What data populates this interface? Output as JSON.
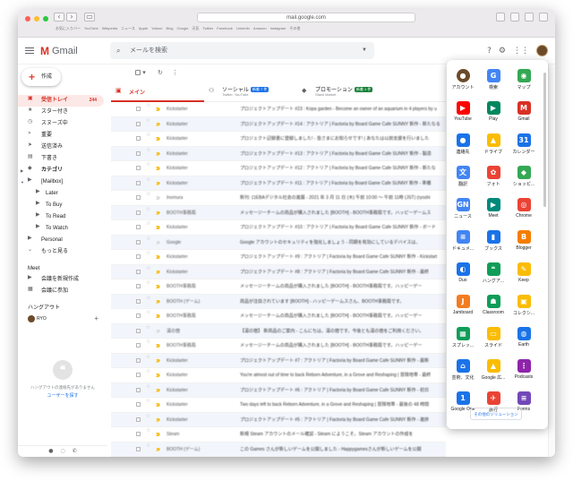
{
  "browser": {
    "url": "mail.google.com",
    "bookmarks": [
      "お気に入りバー",
      "YouTube",
      "Wikipedia",
      "ニュース",
      "Apple",
      "Yahoo!",
      "Bing",
      "Google",
      "天気",
      "Twitter",
      "Facebook",
      "LinkedIn",
      "Amazon",
      "Instagram",
      "その他"
    ]
  },
  "header": {
    "app_name": "Gmail",
    "search_placeholder": "メールを検索"
  },
  "compose": {
    "label": "作成"
  },
  "sidebar": {
    "items": [
      {
        "label": "受信トレイ",
        "icon": "inbox-icon",
        "count": "244",
        "active": true
      },
      {
        "label": "スター付き",
        "icon": "star-icon"
      },
      {
        "label": "スヌーズ中",
        "icon": "clock-icon"
      },
      {
        "label": "重要",
        "icon": "important-icon"
      },
      {
        "label": "送信済み",
        "icon": "send-icon"
      },
      {
        "label": "下書き",
        "icon": "draft-icon"
      },
      {
        "label": "カテゴリ",
        "icon": "category-icon",
        "bold": true
      },
      {
        "label": "[Mailbox]",
        "icon": "label-icon"
      }
    ],
    "mailbox_children": [
      {
        "label": "Later"
      },
      {
        "label": "To Buy"
      },
      {
        "label": "To Read"
      },
      {
        "label": "To Watch"
      }
    ],
    "more_items": [
      {
        "label": "Personal"
      },
      {
        "label": "もっと見る"
      }
    ],
    "meet_title": "Meet",
    "meet_items": [
      {
        "label": "会議を新規作成"
      },
      {
        "label": "会議に参加"
      }
    ],
    "hangouts_title": "ハングアウト",
    "hangouts_user": "RYO",
    "hangouts_empty": "ハングアウトの連絡先がありません",
    "hangouts_link": "ユーザーを探す"
  },
  "tabs": [
    {
      "label": "メイン",
      "icon": "inbox-icon"
    },
    {
      "label": "ソーシャル",
      "badge": "新着 7 件",
      "badge_color": "#1a73e8",
      "sub": "Twitter, YouTube"
    },
    {
      "label": "プロモーション",
      "badge": "新着 1 件",
      "badge_color": "#188038",
      "sub": "Stack Market"
    }
  ],
  "emails": [
    {
      "sender": "Kickstarter",
      "subject": "プロジェクトアップデート #23 : Kopa garden - Become an owner of an aquarium in 4 players by u",
      "important": true
    },
    {
      "sender": "Kickstarter",
      "subject": "プロジェクトアップデート #14 : アクトリア | Factoria by Board Game Cafe SUNNY 新作 - 新たなる",
      "important": true
    },
    {
      "sender": "Kickstarter",
      "subject": "プロジェクト記録書に登録しました! - 皆さまにお知らせです! | あなたは以前支援を行いました",
      "important": true
    },
    {
      "sender": "Kickstarter",
      "subject": "プロジェクトアップデート #13 : アクトリア | Factoria by Board Game Cafe SUNNY 新作 - 製造",
      "important": true
    },
    {
      "sender": "Kickstarter",
      "subject": "プロジェクトアップデート #12 : アクトリア | Factoria by Board Game Cafe SUNNY 新作 - 新たな",
      "important": true
    },
    {
      "sender": "Kickstarter",
      "subject": "プロジェクトアップデート #11 : アクトリア | Factoria by Board Game Cafe SUNNY 新作 - 準備",
      "important": true
    },
    {
      "sender": "Inomura",
      "subject": "新刊: ロEBAデジタル社会の進展 - 2021 年 3 月 11 日 (木) 午前 10:00 ～ 午前 11時 (JST) (ryoshi",
      "important": false
    },
    {
      "sender": "BOOTH事務局",
      "subject": "メッセージーチームの商品が購入されました [BOOTH] - BOOTH事務局です。ハッピーゲームス",
      "important": true
    },
    {
      "sender": "Kickstarter",
      "subject": "プロジェクトアップデート #10 : アクトリア | Factoria by Board Game Cafe SUNNY 新作 - ボード",
      "important": true
    },
    {
      "sender": "Google",
      "subject": "Google アカウントのセキュリティを強化しましょう - 同期を有効にしているデバイスは、",
      "important": false
    },
    {
      "sender": "Kickstarter",
      "subject": "プロジェクトアップデート #9 : アクトリア | Factoria by Board Game Cafe SUNNY 新作 - Kickstart",
      "important": true
    },
    {
      "sender": "Kickstarter",
      "subject": "プロジェクトアップデート #8 : アクトリア | Factoria by Board Game Cafe SUNNY 新作 - 最終",
      "important": true
    },
    {
      "sender": "BOOTH事務局",
      "subject": "メッセージーチームの商品が購入されました [BOOTH] - BOOTH事務局です。ハッピーゲー",
      "important": true
    },
    {
      "sender": "BOOTH (ゲーム)",
      "subject": "商品が注目されています [BOOTH] - ハッピーゲームスさん、BOOTH事務局です。",
      "important": true
    },
    {
      "sender": "BOOTH事務局",
      "subject": "メッセージーチームの商品が購入されました [BOOTH] - BOOTH事務局です。ハッピーゲー",
      "important": true
    },
    {
      "sender": "湯の宿",
      "subject": "【湯の宿】 新商品のご案内 - こんにちは。湯の宿です。今後とも湯の宿をご利用ください。",
      "important": false
    },
    {
      "sender": "BOOTH事務局",
      "subject": "メッセージーチームの商品が購入されました [BOOTH] - BOOTH事務局です。ハッピーゲー",
      "important": true
    },
    {
      "sender": "Kickstarter",
      "subject": "プロジェクトアップデート #7 : アクトリア | Factoria by Board Game Cafe SUNNY 新作 - 最新",
      "important": true
    },
    {
      "sender": "Kickstarter",
      "subject": "You're almost out of time to back Reborn Adventure, in a Grove and Reshaping | 冒険地帯 - 最終",
      "important": true
    },
    {
      "sender": "Kickstarter",
      "subject": "プロジェクトアップデート #6 : アクトリア | Factoria by Board Game Cafe SUNNY 新作 - 初日",
      "important": true
    },
    {
      "sender": "Kickstarter",
      "subject": "Two days left to back Reborn Adventure, in a Grove and Reshaping | 冒険地帯 - 最後の 48 時間",
      "important": true
    },
    {
      "sender": "Kickstarter",
      "subject": "プロジェクトアップデート #5 : アクトリア | Factoria by Board Game Cafe SUNNY 新作 - 進捗",
      "important": true
    },
    {
      "sender": "Steam",
      "subject": "新規 Steam アカウントのメール確認 - Steam にようこそ。Steam アカウントの作成を",
      "important": true
    },
    {
      "sender": "BOOTH (ゲーム)",
      "subject": "この Games さんが新しいゲームを公開しました - Happygamesさんが新しいゲームを公開",
      "important": true
    },
    {
      "sender": "BOOTH事務局",
      "subject": "メッセージーチームの商品が購入されました [BOOTH] - BOOTH事務局です。",
      "important": true
    }
  ],
  "apps": [
    {
      "label": "アカウント",
      "icon": "account-icon",
      "color": "#6b4a2a",
      "glyph": "●"
    },
    {
      "label": "検索",
      "icon": "google-search-icon",
      "color": "#4285f4",
      "glyph": "G"
    },
    {
      "label": "マップ",
      "icon": "maps-icon",
      "color": "#34a853",
      "glyph": "◉"
    },
    {
      "label": "YouTube",
      "icon": "youtube-icon",
      "color": "#ff0000",
      "glyph": "▶"
    },
    {
      "label": "Play",
      "icon": "play-icon",
      "color": "#01875f",
      "glyph": "▶"
    },
    {
      "label": "Gmail",
      "icon": "gmail-icon",
      "color": "#d93025",
      "glyph": "M"
    },
    {
      "label": "連絡先",
      "icon": "contacts-icon",
      "color": "#1a73e8",
      "glyph": "●"
    },
    {
      "label": "ドライブ",
      "icon": "drive-icon",
      "color": "#fbbc04",
      "glyph": "▲"
    },
    {
      "label": "カレンダー",
      "icon": "calendar-icon",
      "color": "#1a73e8",
      "glyph": "31"
    },
    {
      "label": "翻訳",
      "icon": "translate-icon",
      "color": "#4285f4",
      "glyph": "文"
    },
    {
      "label": "フォト",
      "icon": "photos-icon",
      "color": "#ea4335",
      "glyph": "✿"
    },
    {
      "label": "ショッピ...",
      "icon": "shopping-icon",
      "color": "#34a853",
      "glyph": "◆"
    },
    {
      "label": "ニュース",
      "icon": "news-icon",
      "color": "#4285f4",
      "glyph": "GN"
    },
    {
      "label": "Meet",
      "icon": "meet-icon",
      "color": "#00897b",
      "glyph": "▶"
    },
    {
      "label": "Chrome",
      "icon": "chrome-icon",
      "color": "#ea4335",
      "glyph": "◎"
    },
    {
      "label": "ドキュメ...",
      "icon": "docs-icon",
      "color": "#4285f4",
      "glyph": "≡"
    },
    {
      "label": "ブックス",
      "icon": "books-icon",
      "color": "#1a73e8",
      "glyph": "▮"
    },
    {
      "label": "Blogger",
      "icon": "blogger-icon",
      "color": "#f57d00",
      "glyph": "B"
    },
    {
      "label": "Duo",
      "icon": "duo-icon",
      "color": "#1a73e8",
      "glyph": "◐"
    },
    {
      "label": "ハングア...",
      "icon": "hangouts-icon",
      "color": "#0f9d58",
      "glyph": "❝"
    },
    {
      "label": "Keep",
      "icon": "keep-icon",
      "color": "#fbbc04",
      "glyph": "✎"
    },
    {
      "label": "Jamboard",
      "icon": "jamboard-icon",
      "color": "#f37c20",
      "glyph": "J"
    },
    {
      "label": "Classroom",
      "icon": "classroom-icon",
      "color": "#0f9d58",
      "glyph": "☗"
    },
    {
      "label": "コレクシ...",
      "icon": "collections-icon",
      "color": "#fbbc04",
      "glyph": "▣"
    },
    {
      "label": "スプレッ...",
      "icon": "sheets-icon",
      "color": "#0f9d58",
      "glyph": "▦"
    },
    {
      "label": "スライド",
      "icon": "slides-icon",
      "color": "#fbbc04",
      "glyph": "▭"
    },
    {
      "label": "Earth",
      "icon": "earth-icon",
      "color": "#1a73e8",
      "glyph": "◍"
    },
    {
      "label": "芸術、文化",
      "icon": "arts-culture-icon",
      "color": "#1a73e8",
      "glyph": "⌂"
    },
    {
      "label": "Google 広...",
      "icon": "google-ads-icon",
      "color": "#fbbc04",
      "glyph": "▲"
    },
    {
      "label": "Podcasts",
      "icon": "podcasts-icon",
      "color": "#8e24aa",
      "glyph": "⋮"
    },
    {
      "label": "Google One",
      "icon": "google-one-icon",
      "color": "#1a73e8",
      "glyph": "1"
    },
    {
      "label": "旅行",
      "icon": "travel-icon",
      "color": "#ea4335",
      "glyph": "✈"
    },
    {
      "label": "Forms",
      "icon": "forms-icon",
      "color": "#7248b9",
      "glyph": "≡"
    }
  ],
  "apps_more_label": "その他のソリューション"
}
